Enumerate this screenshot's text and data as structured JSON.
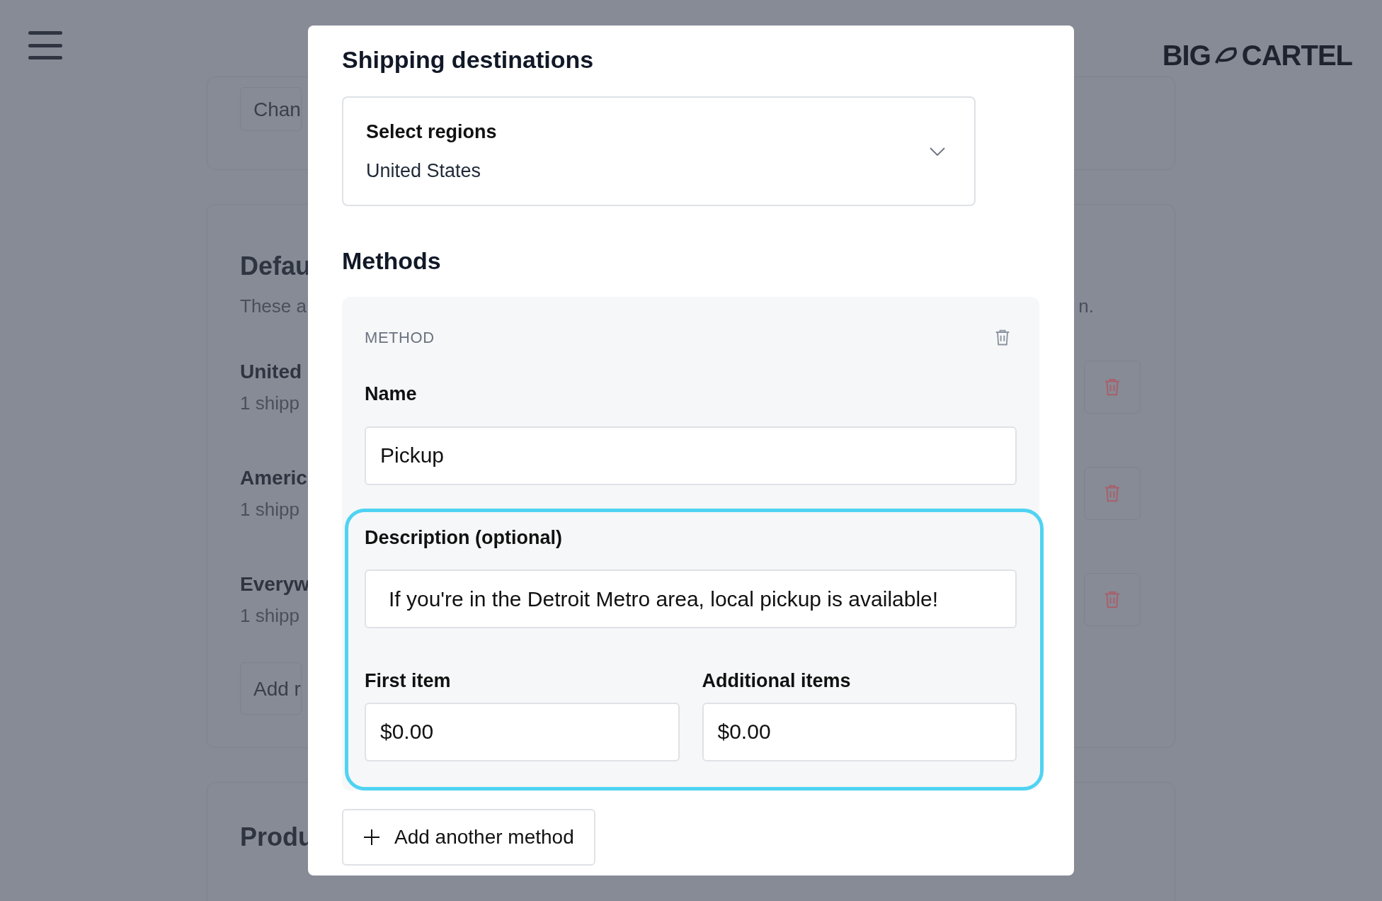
{
  "background_page": {
    "logo": {
      "left": "BIG",
      "right": "CARTEL"
    },
    "change_button": "Chan",
    "default_section": {
      "title": "Defau",
      "description": "These a",
      "description_end": "n.",
      "zones": [
        {
          "name": "United",
          "detail": "1 shipp"
        },
        {
          "name": "Americ",
          "detail": "1 shipp"
        },
        {
          "name": "Everyw",
          "detail": "1 shipp"
        }
      ],
      "add_button": "Add r"
    },
    "products_section": {
      "title": "Produ"
    }
  },
  "modal": {
    "title": "Shipping destinations",
    "regions_select": {
      "label": "Select regions",
      "value": "United States"
    },
    "methods_title": "Methods",
    "methods": [
      {
        "heading": "METHOD",
        "name_label": "Name",
        "name_value": "Pickup",
        "description_label": "Description (optional)",
        "description_value": "If you're in the Detroit Metro area, local pickup is available!",
        "first_item_label": "First item",
        "first_item_value": "$0.00",
        "additional_items_label": "Additional items",
        "additional_items_value": "$0.00",
        "highlighted": true
      }
    ],
    "add_method_button": "Add another method"
  }
}
